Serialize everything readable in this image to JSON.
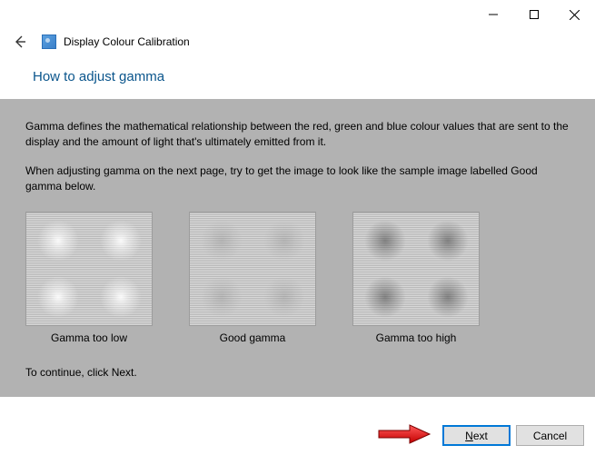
{
  "titlebar": {
    "minimize_tooltip": "Minimize",
    "maximize_tooltip": "Maximize",
    "close_tooltip": "Close"
  },
  "header": {
    "app_title": "Display Colour Calibration",
    "back_tooltip": "Back"
  },
  "page": {
    "heading": "How to adjust gamma",
    "paragraph1": "Gamma defines the mathematical relationship between the red, green and blue colour values that are sent to the display and the amount of light that's ultimately emitted from it.",
    "paragraph2": "When adjusting gamma on the next page, try to get the image to look like the sample image labelled Good gamma below.",
    "continue": "To continue, click Next."
  },
  "samples": {
    "low": "Gamma too low",
    "good": "Good gamma",
    "high": "Gamma too high"
  },
  "footer": {
    "next_label": "Next",
    "cancel_label": "Cancel"
  }
}
